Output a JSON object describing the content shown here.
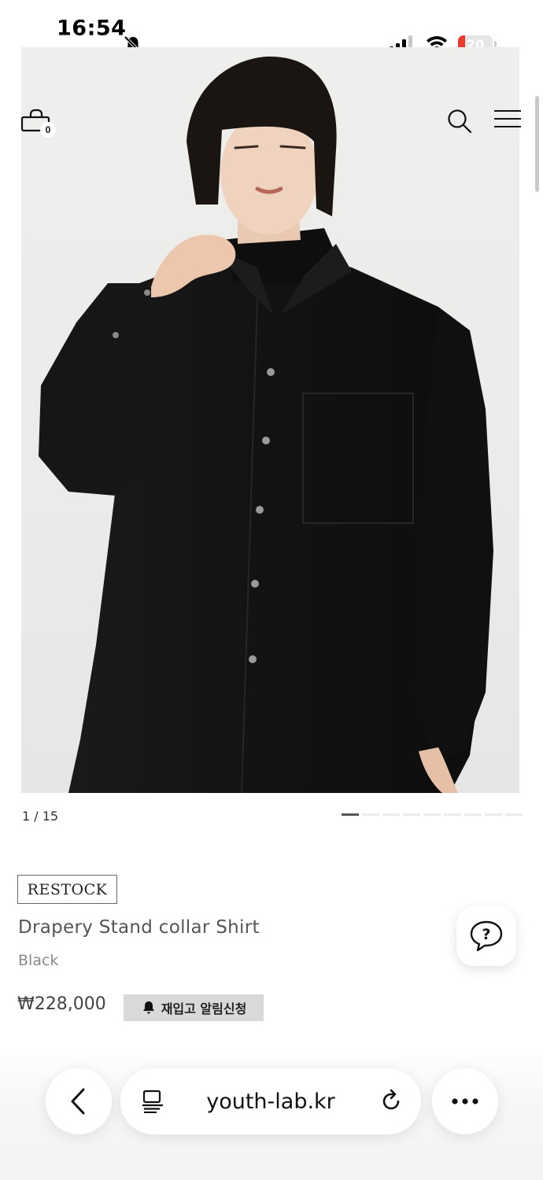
{
  "status_bar": {
    "time": "16:54",
    "battery_level": "20",
    "battery_fraction": 0.2,
    "battery_color": "#ea3b2e"
  },
  "header": {
    "cart_count": "0",
    "icons": [
      "cart-icon",
      "search-icon",
      "menu-icon"
    ]
  },
  "gallery": {
    "pager_text": "1 / 15",
    "current_index": 1,
    "total": 15
  },
  "product": {
    "badge": "RESTOCK",
    "name": "Drapery Stand collar Shirt",
    "color": "Black",
    "price": "₩228,000",
    "restock_alert_label": "재입고 알림신청"
  },
  "browser": {
    "url": "youth-lab.kr",
    "icons": [
      "back-icon",
      "reader-icon",
      "reload-icon",
      "more-icon"
    ]
  },
  "colors": {
    "shirt": "#141414",
    "alert_button_bg": "#d9d9d9"
  }
}
